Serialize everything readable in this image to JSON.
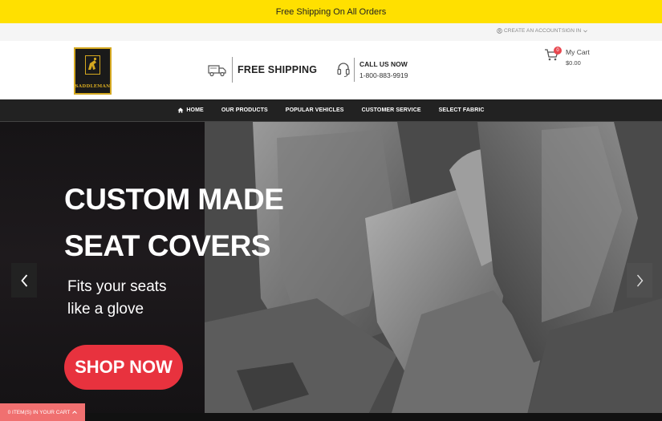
{
  "topbar": {
    "text": "Free Shipping On All Orders"
  },
  "util": {
    "create_account": "CREATE AN ACCOUNT",
    "sign_in": "SIGN IN"
  },
  "header": {
    "logo_text": "SADDLEMAN",
    "shipping_label": "FREE SHIPPING",
    "call_title": "CALL US NOW",
    "call_number": "1-800-883-9919",
    "cart_count": "0",
    "cart_label": "My Cart",
    "cart_total": "$0.00"
  },
  "nav": {
    "items": [
      {
        "label": "HOME",
        "icon": "home-icon"
      },
      {
        "label": "OUR PRODUCTS"
      },
      {
        "label": "POPULAR VEHICLES"
      },
      {
        "label": "CUSTOMER SERVICE"
      },
      {
        "label": "SELECT FABRIC"
      }
    ]
  },
  "hero": {
    "headline_1": "CUSTOM MADE",
    "headline_2": "SEAT COVERS",
    "sub_1": "Fits your seats",
    "sub_2": "like a glove",
    "cta": "SHOP NOW"
  },
  "cart_bar": {
    "text": "0 ITEM(S) IN YOUR CART"
  },
  "colors": {
    "topbar": "#ffe000",
    "nav": "#222222",
    "cta": "#e8323e",
    "cart_bar": "#f07070",
    "logo_gold": "#d4a820"
  }
}
